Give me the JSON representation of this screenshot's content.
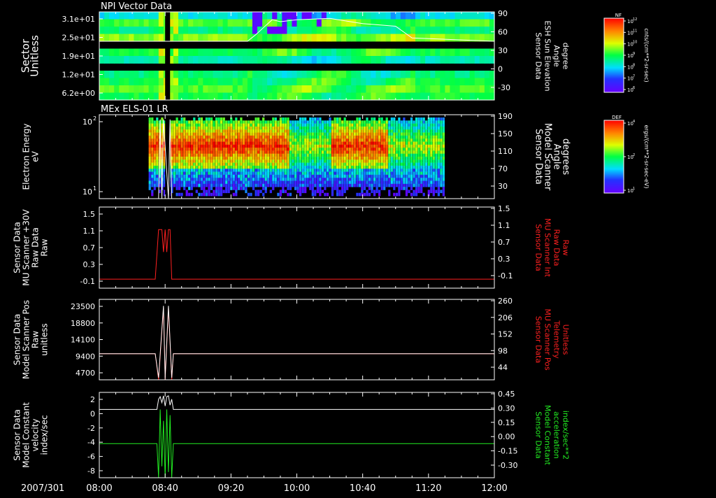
{
  "colors": {
    "background": "#000000",
    "foreground": "#ffffff",
    "red_trace": "#ff2020",
    "green_trace": "#22ee22",
    "white_trace": "#ffffff"
  },
  "chart_data": [
    {
      "type": "heatmap",
      "title": "NPI Vector Data",
      "ylabel_lines": [
        "Sector",
        "Unitless"
      ],
      "y_ticks": [
        "3.1e+01",
        "2.5e+01",
        "1.9e+01",
        "1.2e+01",
        "6.2e+00"
      ],
      "right_ticks": [
        "90",
        "60",
        "30",
        "0",
        "-30"
      ],
      "right_label_lines": [
        "Sensor Data",
        "ESH Sun Elevation",
        "Angle",
        "degree"
      ],
      "overlay": {
        "name": "Sun Elevation",
        "x": [
          "08:00",
          "08:40",
          "08:55",
          "09:30",
          "09:35",
          "09:45",
          "09:50",
          "10:00",
          "10:20",
          "10:40",
          "11:00",
          "11:10",
          "12:00"
        ],
        "y": [
          45,
          45,
          45,
          45,
          55,
          78,
          75,
          78,
          80,
          72,
          68,
          50,
          45
        ]
      },
      "colorbar": {
        "tag": "NF",
        "label": "cnts/(cm**2-sr-sec)",
        "ticks": [
          "10^12",
          "10^11",
          "10^10",
          "10^9",
          "10^8",
          "10^7",
          "10^6"
        ],
        "scale": "log"
      }
    },
    {
      "type": "heatmap",
      "title": "MEx ELS-01 LR",
      "ylabel_lines": [
        "Electron Energy",
        "eV"
      ],
      "y_ticks": [
        "10^2",
        "10^1"
      ],
      "right_ticks": [
        "190",
        "150",
        "110",
        "70",
        "30"
      ],
      "right_label_lines": [
        "Sensor Data",
        "Model Scanner",
        "Angle",
        "degrees"
      ],
      "overlay": {
        "name": "Model Scanner Angle",
        "x": [
          "08:00",
          "08:36",
          "08:37",
          "08:38",
          "08:39",
          "08:42",
          "08:43",
          "08:44",
          "08:45",
          "12:00"
        ],
        "y": [
          10,
          10,
          180,
          10,
          180,
          10,
          180,
          10,
          10,
          10
        ]
      },
      "colorbar": {
        "tag": "DEF",
        "label": "ergs/(cm**2-sr-sec-eV)",
        "ticks": [
          "10^4",
          "10^2",
          "10^1"
        ],
        "scale": "log"
      }
    },
    {
      "type": "line",
      "ylabel_lines": [
        "Sensor Data",
        "MU Scanner +30V",
        "Raw Data",
        "Raw"
      ],
      "y_ticks": [
        "1.5",
        "1.1",
        "0.7",
        "0.3",
        "-0.1"
      ],
      "right_ticks": [
        "1.5",
        "1.1",
        "0.7",
        "0.3",
        "-0.1"
      ],
      "right_label_lines": [
        "Sensor Data",
        "MU Scanner Int",
        "Raw Data",
        "Raw"
      ],
      "ylim": [
        -0.3,
        1.5
      ],
      "series": [
        {
          "name": "MU Scanner Int",
          "x": [
            "08:00",
            "08:34",
            "08:36",
            "08:38",
            "08:39",
            "08:40",
            "08:41",
            "08:42",
            "08:43",
            "08:44",
            "08:45",
            "12:00"
          ],
          "y": [
            -0.1,
            -0.1,
            1.0,
            1.0,
            0.5,
            1.0,
            0.5,
            1.0,
            1.0,
            -0.1,
            -0.1,
            -0.1
          ]
        }
      ]
    },
    {
      "type": "line",
      "ylabel_lines": [
        "Sensor Data",
        "Model Scanner Pos",
        "Raw",
        "unitless"
      ],
      "y_ticks": [
        "23500",
        "18800",
        "14100",
        "9400",
        "4700"
      ],
      "right_ticks": [
        "260",
        "206",
        "152",
        "98",
        "44"
      ],
      "right_label_lines": [
        "Sensor Data",
        "MU Scanner Pos",
        "Telemetry",
        "Unitless"
      ],
      "ylim": [
        0,
        23500
      ],
      "series": [
        {
          "name": "MU Scanner Pos",
          "x": [
            "08:00",
            "08:34",
            "08:36",
            "08:39",
            "08:40",
            "08:42",
            "08:44",
            "08:45",
            "12:00"
          ],
          "y": [
            7600,
            7600,
            0,
            21000,
            0,
            21000,
            0,
            7600,
            7600
          ]
        },
        {
          "name": "Model Scanner Pos",
          "x": [
            "08:00",
            "08:34",
            "08:36",
            "08:39",
            "08:40",
            "08:42",
            "08:44",
            "08:45",
            "12:00"
          ],
          "y": [
            7600,
            7600,
            600,
            21600,
            600,
            21600,
            600,
            7600,
            7600
          ]
        }
      ]
    },
    {
      "type": "line",
      "ylabel_lines": [
        "Sensor Data",
        "Model Constant",
        "velocity",
        "index/sec"
      ],
      "y_ticks": [
        "2",
        "0",
        "-2",
        "-4",
        "-6",
        "-8"
      ],
      "right_ticks": [
        "0.45",
        "0.30",
        "0.15",
        "0.00",
        "-0.15",
        "-0.30"
      ],
      "right_label_lines": [
        "Sensor Data",
        "Model Constant",
        "acceleration",
        "index/sec**2"
      ],
      "ylim": [
        -8,
        2
      ],
      "series": [
        {
          "name": "Model Constant velocity",
          "x": [
            "08:00",
            "08:35",
            "08:36",
            "08:37",
            "08:38",
            "08:39",
            "08:40",
            "08:41",
            "08:42",
            "08:43",
            "08:44",
            "08:45",
            "12:00"
          ],
          "y": [
            0,
            0,
            1.2,
            1.5,
            0.8,
            1.6,
            0.4,
            1.5,
            1.6,
            0.5,
            1.2,
            0,
            0
          ]
        },
        {
          "name": "Model Constant acceleration",
          "x": [
            "08:00",
            "08:35",
            "08:36",
            "08:37",
            "08:38",
            "08:39",
            "08:40",
            "08:41",
            "08:42",
            "08:43",
            "08:44",
            "08:45",
            "12:00"
          ],
          "y": [
            0.0,
            0.0,
            -0.3,
            0.3,
            -0.2,
            0.2,
            -0.3,
            0.3,
            -0.25,
            0.25,
            -0.3,
            0.0,
            0.0
          ]
        }
      ]
    }
  ],
  "x_axis": {
    "date_label": "2007/301",
    "ticks": [
      "08:00",
      "08:40",
      "09:20",
      "10:00",
      "10:40",
      "11:20",
      "12:00"
    ]
  }
}
